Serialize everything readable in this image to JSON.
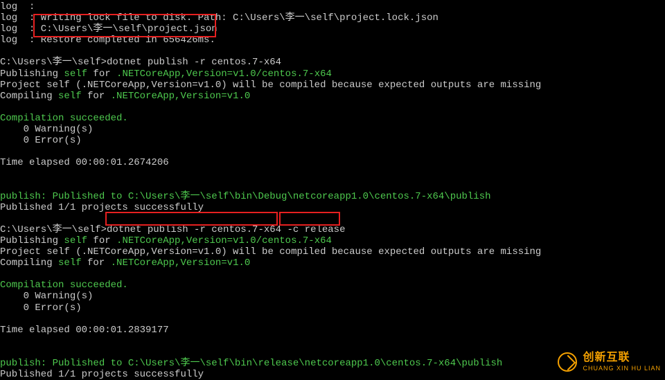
{
  "lines": {
    "l0": "log  :",
    "l1a": "log  : Writing lock file to disk. Path: C:\\Users\\李一\\self\\project.lock.json",
    "l2a": "log  : C:\\Users\\李一\\self\\project.json",
    "l3a": "log  : Restore completed in 656426ms.",
    "prompt1": "C:\\Users\\李一\\self>dotnet publish -r centos.7-x64",
    "pub1a": "Publishing ",
    "pub1b": "self",
    "pub1c": " for ",
    "pub1d": ".NETCoreApp,Version=v1.0/centos.7-x64",
    "proj1": "Project self (.NETCoreApp,Version=v1.0) will be compiled because expected outputs are missing",
    "comp1a": "Compiling ",
    "comp1b": "self",
    "comp1c": " for ",
    "comp1d": ".NETCoreApp,Version=v1.0",
    "succ": "Compilation succeeded.",
    "warn": "    0 Warning(s)",
    "err": "    0 Error(s)",
    "te1": "Time elapsed 00:00:01.2674206",
    "publine1a": "publish: Published to C:\\Users\\李一\\self\\bin\\Debug\\netcoreapp1.0\\centos.7-x64\\publish",
    "pubok": "Published 1/1 projects successfully",
    "prompt2": "C:\\Users\\李一\\self>dotnet publish -r centos.7-x64 -c release",
    "te2": "Time elapsed 00:00:01.2839177",
    "publine2a": "publish: Published to C:\\Users\\李一\\self\\bin\\release\\netcoreapp1.0\\centos.7-x64\\publish"
  },
  "watermark": {
    "big": "创新互联",
    "small": "CHUANG XIN HU LIAN"
  }
}
